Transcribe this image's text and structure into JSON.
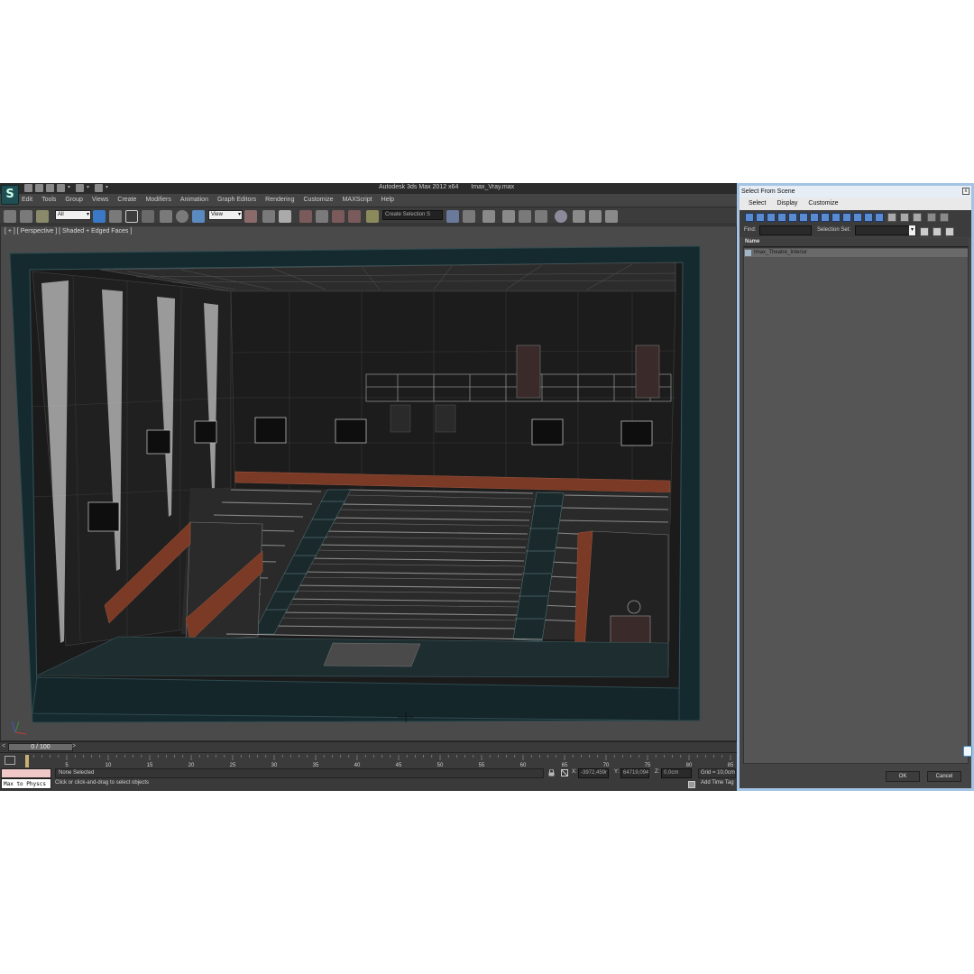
{
  "app": {
    "logo_glyph": "S",
    "title": "Autodesk 3ds Max  2012 x64",
    "filename": "Imax_Vray.max"
  },
  "menu": [
    "Edit",
    "Tools",
    "Group",
    "Views",
    "Create",
    "Modifiers",
    "Animation",
    "Graph Editors",
    "Rendering",
    "Customize",
    "MAXScript",
    "Help"
  ],
  "toolbar": {
    "filter_value": "All",
    "refcoord_value": "View",
    "selection_set_value": "Create Selection S"
  },
  "viewport": {
    "label": "[ + ] [ Perspective ] [ Shaded + Edged Faces ]"
  },
  "timeline": {
    "prev": "<",
    "frame": "0 / 100",
    "next": ">",
    "ticks": [
      "5",
      "10",
      "15",
      "20",
      "25",
      "30",
      "35",
      "40",
      "45",
      "50",
      "55",
      "60",
      "65",
      "70",
      "75",
      "80",
      "85"
    ]
  },
  "status": {
    "maxscript_text": "Max to Physcs",
    "selection": "None Selected",
    "prompt": "Click or click-and-drag to select objects",
    "x_label": "X:",
    "x_value": "-3972,459r",
    "y_label": "Y:",
    "y_value": "64719,094",
    "z_label": "Z:",
    "z_value": "0,0cm",
    "grid": "Grid = 10,0cm",
    "add_time_tag": "Add Time Tag"
  },
  "dialog": {
    "title": "Select From Scene",
    "close": "x",
    "menu": [
      "Select",
      "Display",
      "Customize"
    ],
    "find_label": "Find:",
    "selection_set_label": "Selection Set:",
    "column_name": "Name",
    "items": [
      "Imax_Theatre_Interior"
    ],
    "ok": "OK",
    "cancel": "Cancel"
  },
  "colors": {
    "ui_dark": "#444444",
    "viewport_bg": "#4a4a4a",
    "frame_teal": "#1a3338",
    "wall_dark": "#1e1e1e",
    "wood_red": "#7a3a26",
    "dialog_border": "#a3c4e4"
  }
}
